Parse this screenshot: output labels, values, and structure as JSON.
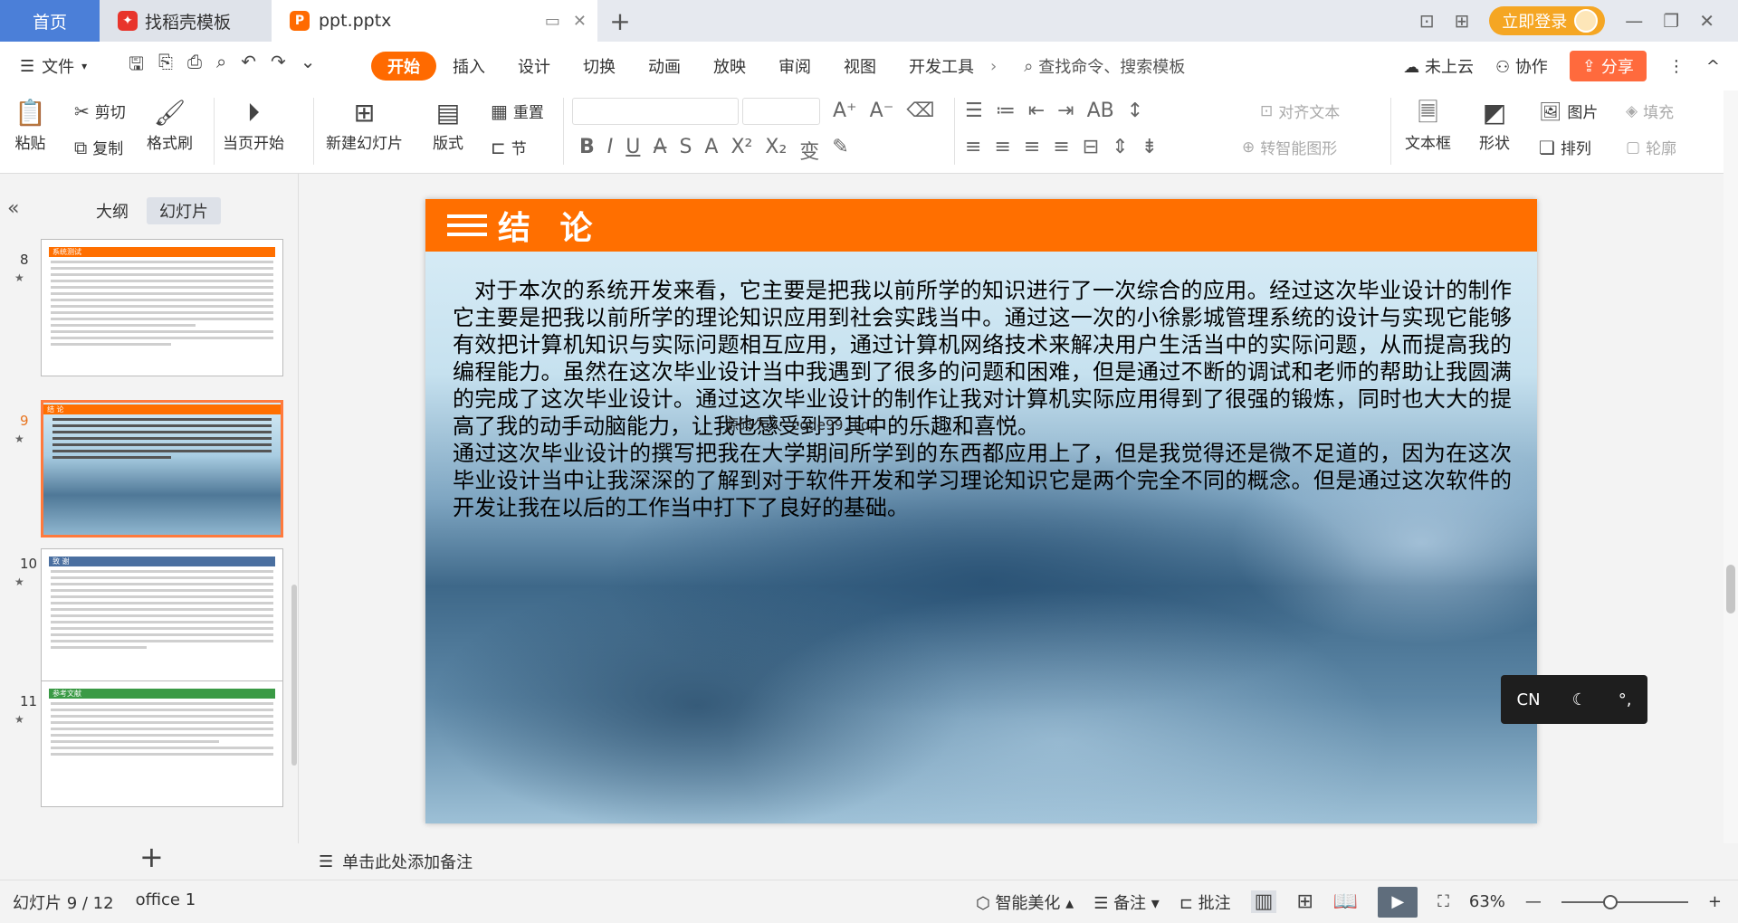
{
  "titlebar": {
    "home_tab": "首页",
    "template_tab": "找稻壳模板",
    "file_tab": "ppt.pptx",
    "login": "立即登录"
  },
  "menubar": {
    "file": "文件",
    "tabs": [
      "开始",
      "插入",
      "设计",
      "切换",
      "动画",
      "放映",
      "审阅",
      "视图",
      "开发工具"
    ],
    "active_tab": "开始",
    "search_placeholder": "查找命令、搜索模板",
    "cloud": "未上云",
    "collab": "协作",
    "share": "分享"
  },
  "ribbon": {
    "paste": "粘贴",
    "cut": "剪切",
    "copy": "复制",
    "format_painter": "格式刷",
    "play_current": "当页开始",
    "new_slide": "新建幻灯片",
    "layout": "版式",
    "section": "节",
    "reset": "重置",
    "align_text": "对齐文本",
    "smart_shape": "转智能图形",
    "textbox": "文本框",
    "shape": "形状",
    "picture": "图片",
    "arrange": "排列",
    "fill": "填充",
    "outline": "轮廓",
    "accent_color": "#ff6a00"
  },
  "leftpanel": {
    "outline_tab": "大纲",
    "slides_tab": "幻灯片",
    "slides": [
      {
        "num": "8",
        "title": "系统测试",
        "header_color": "#ff6f00",
        "style": "text"
      },
      {
        "num": "9",
        "title": "结 论",
        "header_color": "#ff6f00",
        "style": "image",
        "active": true
      },
      {
        "num": "10",
        "title": "致 谢",
        "header_color": "#4a6fa0",
        "style": "text"
      },
      {
        "num": "11",
        "title": "参考文献",
        "header_color": "#3a9a45",
        "style": "text"
      }
    ]
  },
  "slide": {
    "title": "结 论",
    "paragraph1": "对于本次的系统开发来看，它主要是把我以前所学的知识进行了一次综合的应用。经过这次毕业设计的制作它主要是把我以前所学的理论知识应用到社会实践当中。通过这一次的小徐影城管理系统的设计与实现它能够有效把计算机知识与实际问题相互应用，通过计算机网络技术来解决用户生活当中的实际问题，从而提高我的编程能力。虽然在这次毕业设计当中我遇到了很多的问题和困难，但是通过不断的调试和老师的帮助让我圆满的完成了这次毕业设计。通过这次毕业设计的制作让我对计算机实际应用得到了很强的锻炼，同时也大大的提高了我的动手动脑能力，让我也感受到了其中的乐趣和喜悦。",
    "paragraph2": "通过这次毕业设计的撰写把我在大学期间所学到的东西都应用上了，但是我觉得还是微不足道的，因为在这次毕业设计当中让我深深的了解到对于软件开发和学习理论知识它是两个完全不同的概念。但是通过这次软件的开发让我在以后的工作当中打下了良好的基础。",
    "watermark": "源码久久-code99.top"
  },
  "ime": {
    "lang": "CN"
  },
  "notes": {
    "placeholder": "单击此处添加备注"
  },
  "status": {
    "slide_counter": "幻灯片 9 / 12",
    "theme": "office 1",
    "beautify": "智能美化",
    "notes": "备注",
    "comments": "批注",
    "zoom": "63%",
    "zoom_fraction": 0.63
  }
}
